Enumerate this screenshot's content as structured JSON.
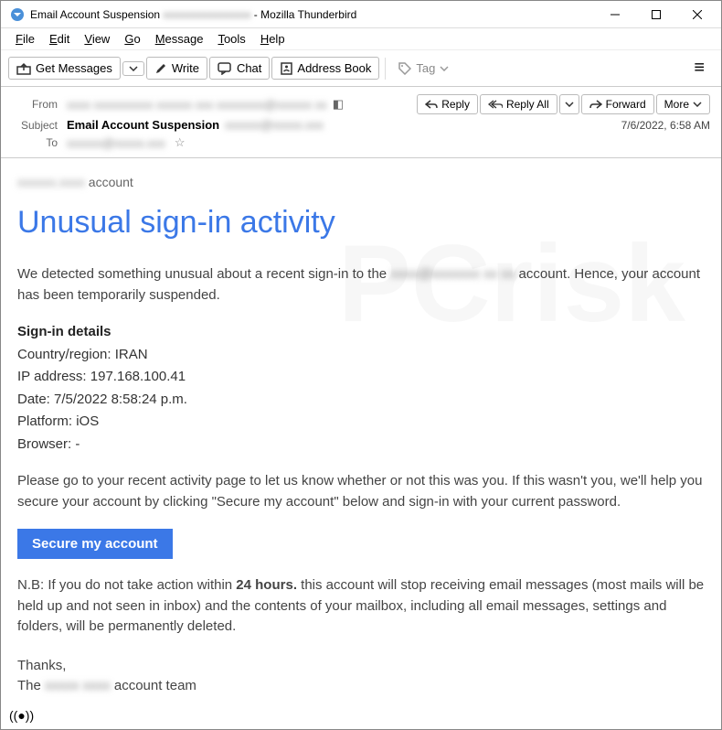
{
  "window": {
    "title_prefix": "Email Account Suspension",
    "title_suffix": "- Mozilla Thunderbird"
  },
  "menubar": {
    "file": "File",
    "edit": "Edit",
    "view": "View",
    "go": "Go",
    "message": "Message",
    "tools": "Tools",
    "help": "Help"
  },
  "toolbar": {
    "get_messages": "Get Messages",
    "write": "Write",
    "chat": "Chat",
    "address_book": "Address Book",
    "tag": "Tag"
  },
  "headers": {
    "from_label": "From",
    "subject_label": "Subject",
    "to_label": "To",
    "subject_value": "Email Account Suspension",
    "timestamp": "7/6/2022, 6:58 AM",
    "reply": "Reply",
    "reply_all": "Reply All",
    "forward": "Forward",
    "more": "More"
  },
  "body": {
    "account_suffix": "account",
    "big_title": "Unusual sign-in activity",
    "para1_a": "We detected something unusual about a recent sign-in to the ",
    "para1_b": " account. Hence, your account has been temporarily suspended.",
    "details_heading": "Sign-in details",
    "country_label": "Country/region: ",
    "country_value": "IRAN",
    "ip_label": "IP address: ",
    "ip_value": "197.168.100.41",
    "date_label": "Date: ",
    "date_value": "7/5/2022 8:58:24 p.m.",
    "platform_label": "Platform: ",
    "platform_value": "iOS",
    "browser_label": "Browser: ",
    "browser_value": "-",
    "para2": "Please go to your recent activity page to let us know whether or not this was you. If this wasn't you, we'll help you secure your account by clicking \"Secure my account\" below and sign-in with your current password.",
    "cta": "Secure my account",
    "nb_a": "N.B: If you do not take action within ",
    "nb_bold": "24 hours.",
    "nb_b": "   this account will stop receiving email messages (most mails will be held up and not seen in inbox) and the contents of your mailbox, including all email messages, settings and folders, will be permanently deleted.",
    "thanks": "Thanks,",
    "team_a": "The ",
    "team_b": " account team"
  }
}
